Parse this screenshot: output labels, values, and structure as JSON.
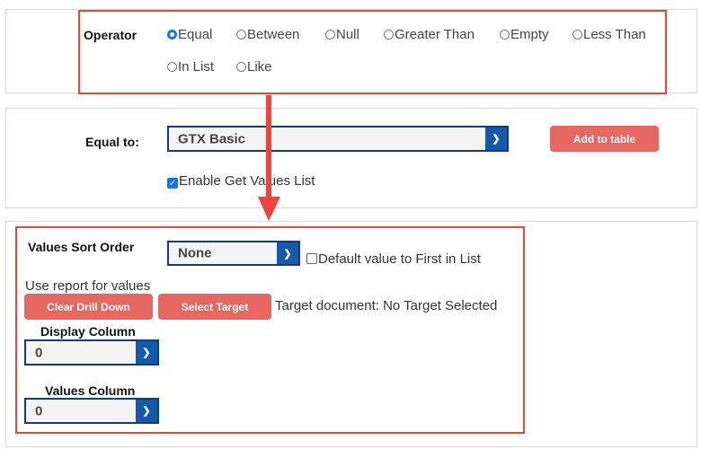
{
  "operator": {
    "label": "Operator",
    "options": [
      "Equal",
      "Between",
      "Null",
      "Greater Than",
      "Empty",
      "Less Than",
      "In List",
      "Like"
    ],
    "selected": "Equal"
  },
  "equal_to": {
    "label": "Equal to:",
    "value": "GTX Basic",
    "add_button": "Add to table",
    "enable_get_values": {
      "label": "Enable Get Values List",
      "checked": true
    }
  },
  "values": {
    "sort_order_label": "Values Sort Order",
    "sort_order_value": "None",
    "default_first": {
      "label": "Default value to First in List",
      "checked": false
    },
    "use_report_label": "Use report for values",
    "clear_drill_down": "Clear Drill Down",
    "select_target": "Select Target",
    "target_document": "Target document: No Target Selected",
    "display_column_label": "Display Column",
    "display_column_value": "0",
    "values_column_label": "Values Column",
    "values_column_value": "0"
  },
  "colors": {
    "highlight": "#f0443a",
    "accent": "#1559ad",
    "button": "#e66761"
  }
}
